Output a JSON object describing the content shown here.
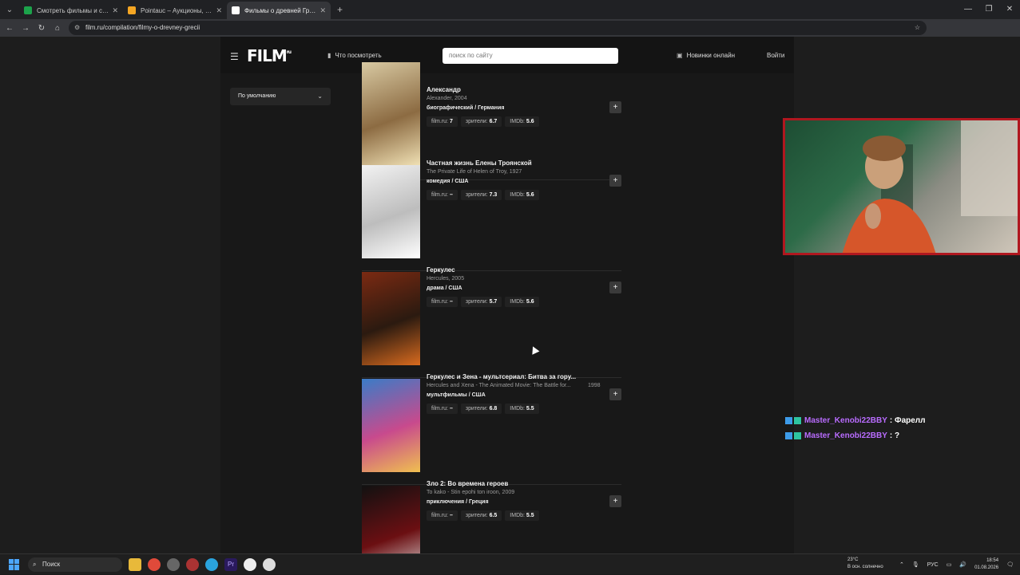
{
  "browser": {
    "tabs": [
      {
        "title": "Смотреть фильмы и сериалы",
        "favicon_color": "#1ca34b"
      },
      {
        "title": "Pointauc – Аукционы, лотереи",
        "favicon_color": "#f5a623"
      },
      {
        "title": "Фильмы о древней Греции",
        "favicon_color": "#ffffff",
        "active": true
      }
    ],
    "new_tab": "+",
    "url": "film.ru/compilation/filmy-o-drevney-grecii"
  },
  "site": {
    "logo": "FILM",
    "logo_sup": "ru",
    "what_to_watch": "Что посмотреть",
    "search_placeholder": "поиск по сайту",
    "new_online": "Новинки онлайн",
    "login": "Войти",
    "sort_label": "По умолчанию"
  },
  "films": [
    {
      "title": "Александр",
      "original": "Alexander, 2004",
      "genre": "биографический / Германия",
      "filmru": "7",
      "viewers": "6.7",
      "imdb": "5.6",
      "poster": [
        "#d8c9a2",
        "#8c6b42",
        "#f2e3b7"
      ]
    },
    {
      "title": "Частная жизнь Елены Троянской",
      "original": "The Private Life of Helen of Troy, 1927",
      "genre": "комедия / США",
      "filmru": "–",
      "viewers": "7.3",
      "imdb": "5.6",
      "poster": [
        "#f2f2f2",
        "#bdbdbd",
        "#ffffff"
      ]
    },
    {
      "title": "Геркулес",
      "original": "Hercules, 2005",
      "genre": "драма / США",
      "filmru": "–",
      "viewers": "5.7",
      "imdb": "5.6",
      "poster": [
        "#7b2a12",
        "#2b1a10",
        "#d96b1f"
      ]
    },
    {
      "title": "Геркулес и Зена - мультсериал: Битва за гору...",
      "original": "Hercules and Xena - The Animated Movie: The Battle for...",
      "year": "1998",
      "genre": "мультфильмы / США",
      "filmru": "–",
      "viewers": "6.8",
      "imdb": "5.5",
      "poster": [
        "#3a7cc7",
        "#c84a8d",
        "#f0c050"
      ]
    },
    {
      "title": "Зло 2: Во времена героев",
      "original": "To kako - Stin epohi ton iroon, 2009",
      "genre": "приключения / Греция",
      "filmru": "–",
      "viewers": "6.5",
      "imdb": "5.5",
      "poster": [
        "#111111",
        "#6b0f12",
        "#e2e2e2"
      ]
    }
  ],
  "rating_labels": {
    "filmru": "film.ru:",
    "viewers": "зрители:",
    "imdb": "IMDb:"
  },
  "chat": [
    {
      "user": "Master_Kenobi22BBY",
      "message": ": Фарелл"
    },
    {
      "user": "Master_Kenobi22BBY",
      "message": ": ?"
    }
  ],
  "taskbar": {
    "search": "Поиск",
    "weather_temp": "23°C",
    "weather_desc": "В осн. солнечно",
    "lang": "РУС",
    "time": "18:54",
    "date": "01.08.2026"
  }
}
